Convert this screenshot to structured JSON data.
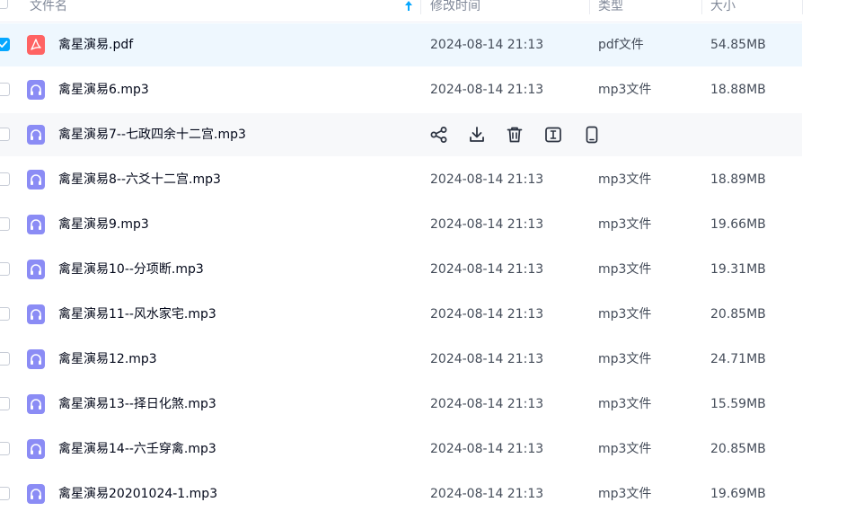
{
  "header": {
    "name": "文件名",
    "time": "修改时间",
    "type": "类型",
    "size": "大小"
  },
  "rows": [
    {
      "name": "禽星演易.pdf",
      "time": "2024-08-14 21:13",
      "type": "pdf文件",
      "size": "54.85MB",
      "icon": "pdf-icon"
    },
    {
      "name": "禽星演易6.mp3",
      "time": "2024-08-14 21:13",
      "type": "mp3文件",
      "size": "18.88MB",
      "icon": "audio-icon"
    },
    {
      "name": "禽星演易7--七政四余十二宫.mp3",
      "time": "",
      "type": "",
      "size": "",
      "icon": "audio-icon"
    },
    {
      "name": "禽星演易8--六爻十二宫.mp3",
      "time": "2024-08-14 21:13",
      "type": "mp3文件",
      "size": "18.89MB",
      "icon": "audio-icon"
    },
    {
      "name": "禽星演易9.mp3",
      "time": "2024-08-14 21:13",
      "type": "mp3文件",
      "size": "19.66MB",
      "icon": "audio-icon"
    },
    {
      "name": "禽星演易10--分项断.mp3",
      "time": "2024-08-14 21:13",
      "type": "mp3文件",
      "size": "19.31MB",
      "icon": "audio-icon"
    },
    {
      "name": "禽星演易11--风水家宅.mp3",
      "time": "2024-08-14 21:13",
      "type": "mp3文件",
      "size": "20.85MB",
      "icon": "audio-icon"
    },
    {
      "name": "禽星演易12.mp3",
      "time": "2024-08-14 21:13",
      "type": "mp3文件",
      "size": "24.71MB",
      "icon": "audio-icon"
    },
    {
      "name": "禽星演易13--择日化煞.mp3",
      "time": "2024-08-14 21:13",
      "type": "mp3文件",
      "size": "15.59MB",
      "icon": "audio-icon"
    },
    {
      "name": "禽星演易14--六壬穿禽.mp3",
      "time": "2024-08-14 21:13",
      "type": "mp3文件",
      "size": "20.85MB",
      "icon": "audio-icon"
    },
    {
      "name": "禽星演易20201024-1.mp3",
      "time": "2024-08-14 21:13",
      "type": "mp3文件",
      "size": "19.69MB",
      "icon": "audio-icon"
    }
  ],
  "hover_actions": [
    "share-icon",
    "download-icon",
    "delete-icon",
    "rename-icon",
    "phone-icon"
  ],
  "colors": {
    "accent": "#06a7ff",
    "pdf": "#ff5b5b",
    "audio": "#8b8cf5",
    "selected_row": "#eef7fe",
    "hovered_row": "#f7f8fa"
  }
}
